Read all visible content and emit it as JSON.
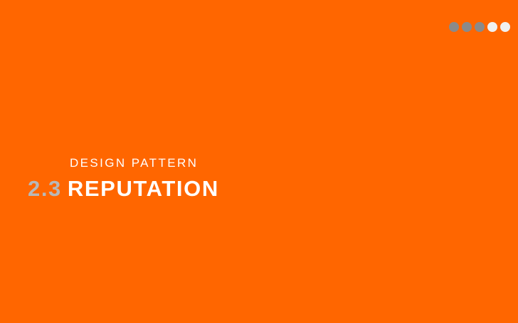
{
  "slide": {
    "kicker": "DESIGN PATTERN",
    "section_number": "2.3",
    "section_title": "REPUTATION"
  },
  "progress": {
    "total_steps": 5,
    "completed_steps": 3
  },
  "colors": {
    "background": "#ff6600",
    "dot_completed": "#8a8a8a",
    "dot_remaining": "#f0f0f0",
    "section_number": "#b8b8b8",
    "text": "#ffffff"
  }
}
